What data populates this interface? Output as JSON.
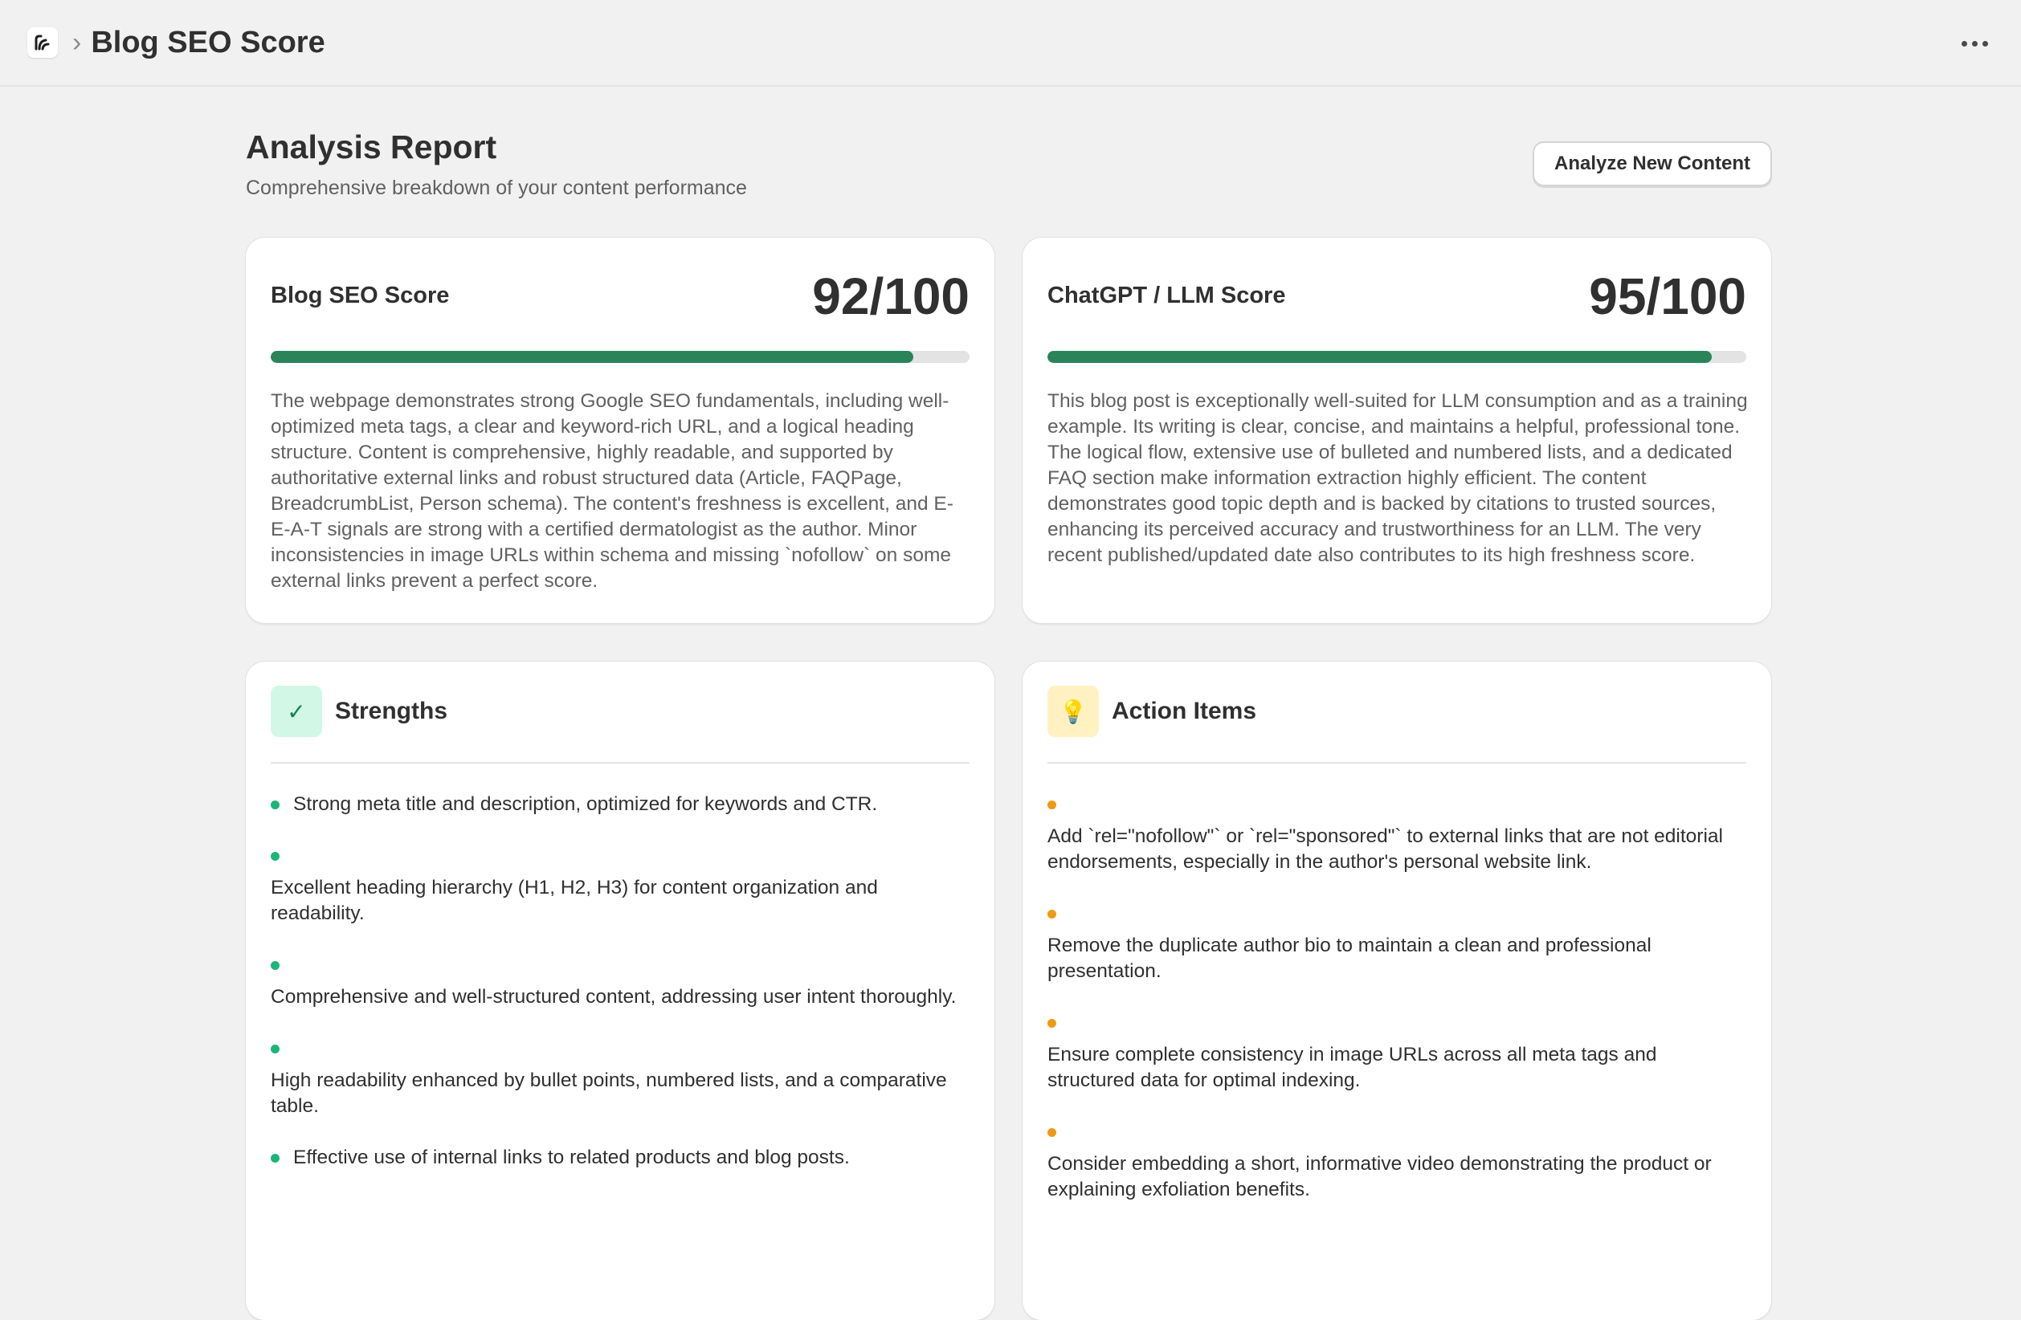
{
  "topbar": {
    "title": "Blog SEO Score",
    "breadcrumb_separator": "›",
    "app_icon": "app-logo-icon",
    "menu_icon": "more-horizontal-icon"
  },
  "header": {
    "title": "Analysis Report",
    "subtitle": "Comprehensive breakdown of your content performance",
    "analyze_button": "Analyze New Content"
  },
  "scores": [
    {
      "label": "Blog SEO Score",
      "value": "92/100",
      "progress": 0.92,
      "description": "The webpage demonstrates strong Google SEO fundamentals, including well-optimized meta tags, a clear and keyword-rich URL, and a logical heading structure. Content is comprehensive, highly readable, and supported by authoritative external links and robust structured data (Article, FAQPage, BreadcrumbList, Person schema). The content's freshness is excellent, and E-E-A-T signals are strong with a certified dermatologist as the author. Minor inconsistencies in image URLs within schema and missing `nofollow` on some external links prevent a perfect score."
    },
    {
      "label": "ChatGPT / LLM Score",
      "value": "95/100",
      "progress": 0.95,
      "description": "This blog post is exceptionally well-suited for LLM consumption and as a training example. Its writing is clear, concise, and maintains a helpful, professional tone. The logical flow, extensive use of bulleted and numbered lists, and a dedicated FAQ section make information extraction highly efficient. The content demonstrates good topic depth and is backed by citations to trusted sources, enhancing its perceived accuracy and trustworthiness for an LLM. The very recent published/updated date also contributes to its high freshness score."
    }
  ],
  "strengths": {
    "title": "Strengths",
    "icon": "check-icon",
    "icon_glyph": "✓",
    "accent": "#1bb57a",
    "items": [
      "Strong meta title and description, optimized for keywords and CTR.",
      "Excellent heading hierarchy (H1, H2, H3) for content organization and readability.",
      "Comprehensive and well-structured content, addressing user intent thoroughly.",
      "High readability enhanced by bullet points, numbered lists, and a comparative table.",
      "Effective use of internal links to related products and blog posts."
    ]
  },
  "actions": {
    "title": "Action Items",
    "icon": "lightbulb-icon",
    "icon_glyph": "💡",
    "accent": "#ef9a14",
    "items": [
      "Add `rel=\"nofollow\"` or `rel=\"sponsored\"` to external links that are not editorial endorsements, especially in the author's personal website link.",
      "Remove the duplicate author bio to maintain a clean and professional presentation.",
      "Ensure complete consistency in image URLs across all meta tags and structured data for optimal indexing.",
      "Consider embedding a short, informative video demonstrating the product or explaining exfoliation benefits."
    ]
  }
}
